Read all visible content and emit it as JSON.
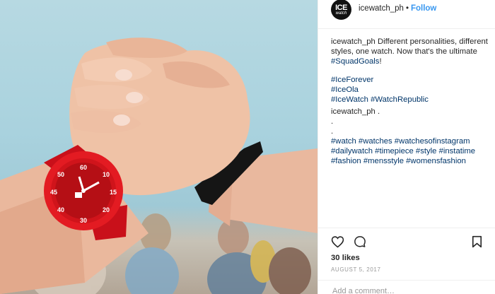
{
  "header": {
    "avatar_line1": "ICE",
    "avatar_line2": "watch",
    "username": "icewatch_ph",
    "separator": "•",
    "follow_label": "Follow"
  },
  "caption": {
    "username": "icewatch_ph",
    "text": "Different personalities, different styles, one watch. Now that's the ultimate",
    "squad_tag": "#SquadGoals",
    "squad_suffix": "!",
    "tag_lines": [
      "#IceForever",
      "#IceOla",
      "#IceWatch #WatchRepublic"
    ],
    "comment_user": "icewatch_ph",
    "comment_dots": [
      ".",
      ".",
      "."
    ],
    "hashtag_lines": [
      "#watch #watches #watchesofinstagram",
      "#dailywatch #timepiece #style #instatime",
      "#fashion #mensstyle #womensfashion"
    ]
  },
  "actions": {
    "like_icon": "heart-outline-icon",
    "comment_icon": "comment-bubble-icon",
    "save_icon": "bookmark-icon"
  },
  "likes": "30 likes",
  "date": "AUGUST 5, 2017",
  "comment_placeholder": "Add a comment…",
  "colors": {
    "follow": "#3897f0",
    "hashtag": "#003569",
    "watch_red": "#d9141a",
    "muted": "#999999"
  }
}
